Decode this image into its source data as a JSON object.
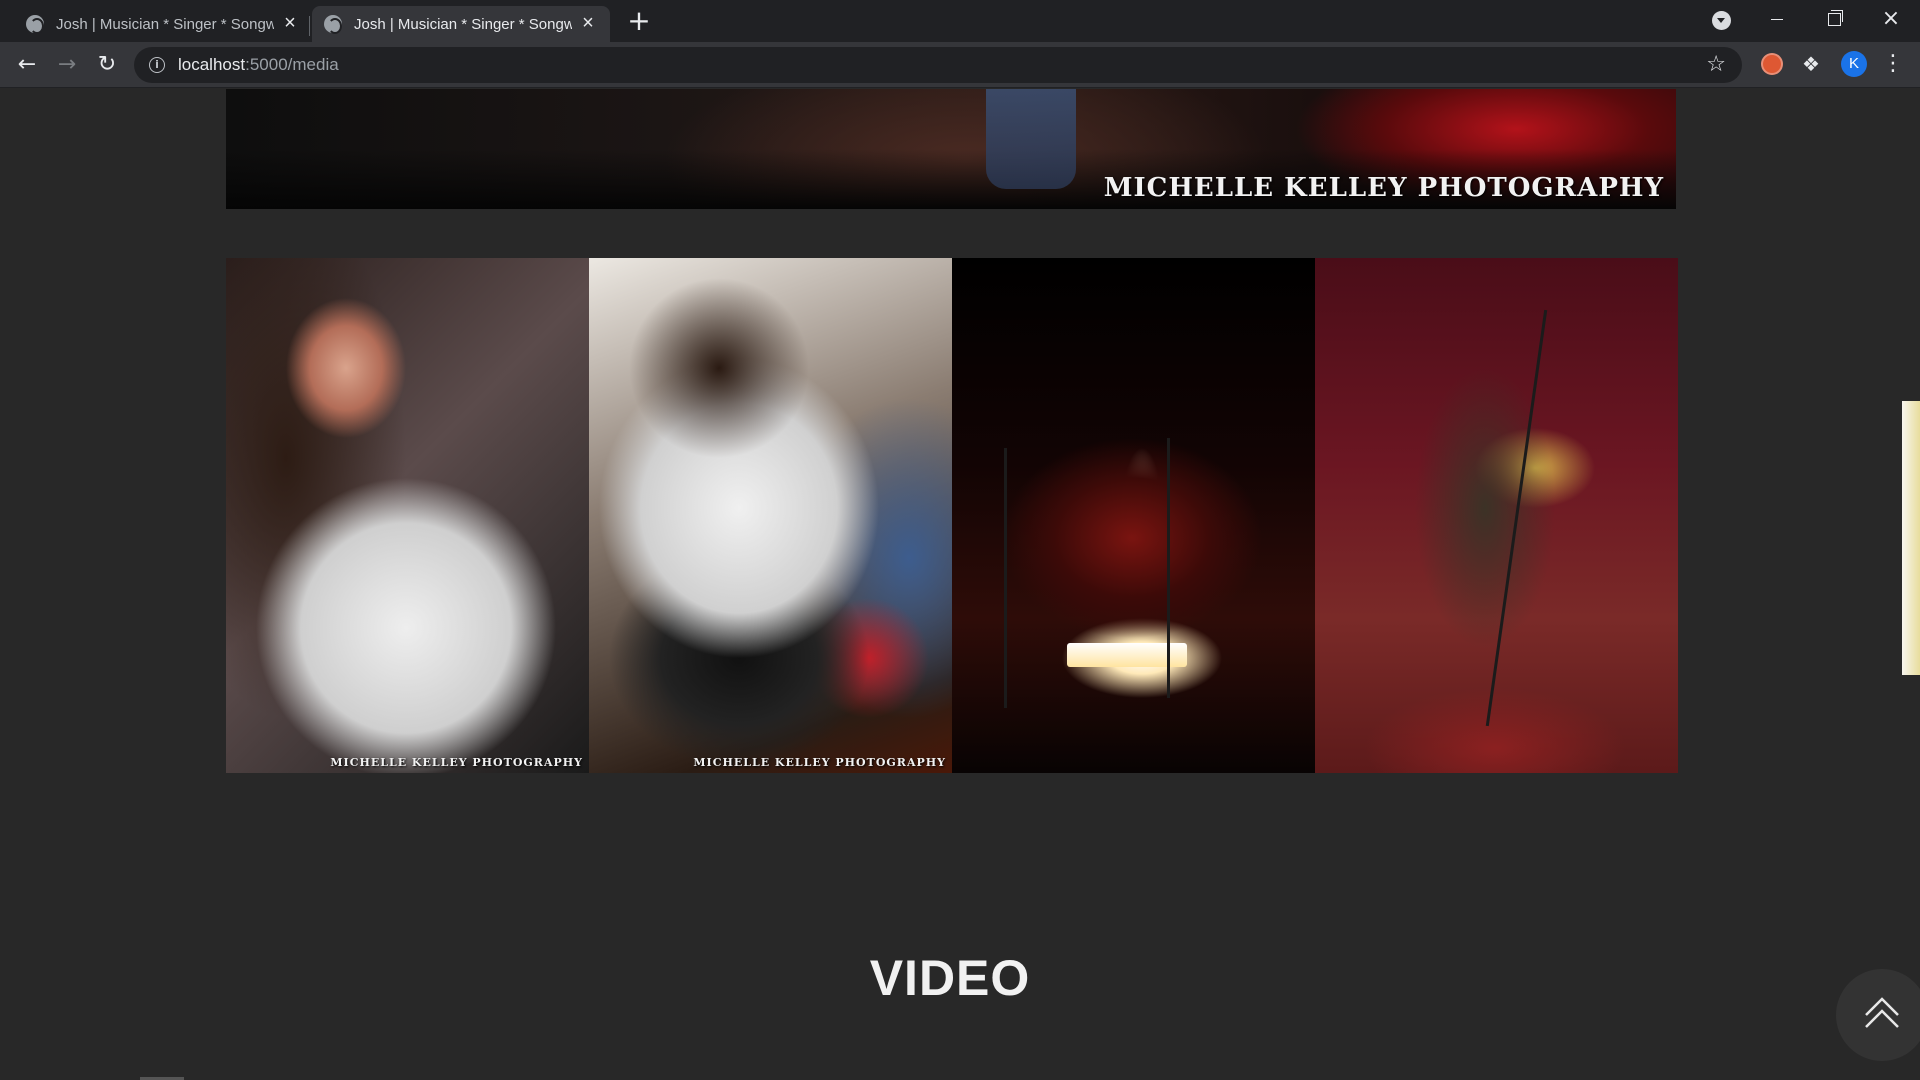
{
  "browser": {
    "tabs": [
      {
        "title": "Josh | Musician * Singer * Songwriter",
        "active": false
      },
      {
        "title": "Josh | Musician * Singer * Songwriter",
        "active": true
      }
    ],
    "new_tab_label": "+",
    "close_glyph": "×",
    "url_host": "localhost",
    "url_path": ":5000/media",
    "profile_initial": "K",
    "icons": {
      "back": "back-arrow-icon",
      "forward": "forward-arrow-icon",
      "reload": "reload-icon",
      "info": "info-icon",
      "star": "star-icon",
      "extensions": "puzzle-icon",
      "menu": "kebab-menu-icon"
    }
  },
  "page": {
    "banner_watermark": "MICHELLE KELLEY PHOTOGRAPHY",
    "gallery": [
      {
        "alt": "Singer at microphone",
        "watermark": "MICHELLE KELLEY PHOTOGRAPHY"
      },
      {
        "alt": "Guitarist playing black guitar",
        "watermark": "MICHELLE KELLEY PHOTOGRAPHY"
      },
      {
        "alt": "Band on stage with lights",
        "watermark": ""
      },
      {
        "alt": "Guitarist on red-curtained stage",
        "watermark": ""
      }
    ],
    "section_title": "VIDEO",
    "scroll_top_icon": "double-chevron-up-icon"
  }
}
